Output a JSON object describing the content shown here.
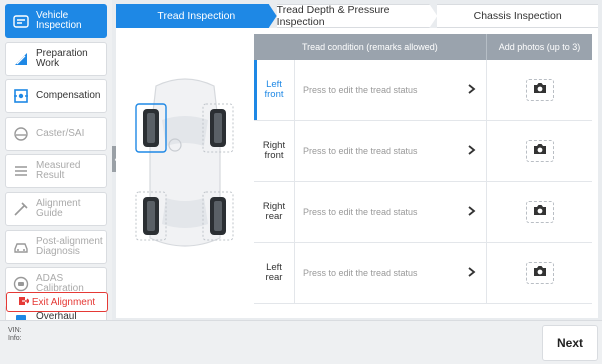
{
  "sidebar": {
    "items": [
      {
        "label": "Vehicle\nInspection",
        "icon": "vehicle-inspection-icon",
        "state": "active"
      },
      {
        "label": "Preparation\nWork",
        "icon": "preparation-icon",
        "state": "normal"
      },
      {
        "label": "Compensation",
        "icon": "compensation-icon",
        "state": "normal"
      },
      {
        "label": "Caster/SAI",
        "icon": "caster-icon",
        "state": "disabled"
      },
      {
        "label": "Measured\nResult",
        "icon": "measured-result-icon",
        "state": "disabled"
      },
      {
        "label": "Alignment\nGuide",
        "icon": "alignment-guide-icon",
        "state": "disabled"
      },
      {
        "label": "Post-alignment\nDiagnosis",
        "icon": "post-alignment-icon",
        "state": "disabled"
      },
      {
        "label": "ADAS\nCalibration",
        "icon": "adas-icon",
        "state": "disabled"
      },
      {
        "label": "Overhaul Report",
        "icon": "report-icon",
        "state": "normal"
      }
    ],
    "exit_label": "Exit Alignment"
  },
  "tabs": [
    {
      "label": "Tread Inspection",
      "active": true
    },
    {
      "label": "Tread Depth & Pressure Inspection",
      "active": false
    },
    {
      "label": "Chassis Inspection",
      "active": false
    }
  ],
  "table": {
    "col_condition": "Tread condition (remarks allowed)",
    "col_photos": "Add photos (up to 3)",
    "rows": [
      {
        "position": "Left\nfront",
        "edit_text": "Press to edit the tread status",
        "active": true
      },
      {
        "position": "Right\nfront",
        "edit_text": "Press to edit the tread status",
        "active": false
      },
      {
        "position": "Right\nrear",
        "edit_text": "Press to edit the tread status",
        "active": false
      },
      {
        "position": "Left\nrear",
        "edit_text": "Press to edit the tread status",
        "active": false
      }
    ]
  },
  "footer": {
    "vin_label": "VIN:",
    "info_label": "Info:",
    "next_label": "Next"
  },
  "colors": {
    "accent": "#1e88e5",
    "exit": "#e53935",
    "header": "#9aa3ad"
  }
}
